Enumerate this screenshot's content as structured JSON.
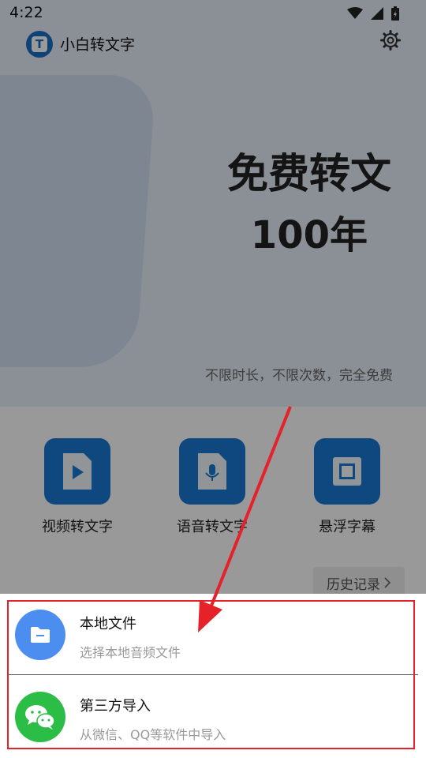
{
  "status_bar": {
    "time": "4:22",
    "icons": [
      "wifi-icon",
      "signal-icon",
      "battery-charging-icon"
    ]
  },
  "app": {
    "name": "小白转文字",
    "logo_letter": "T",
    "settings_icon": "gear-icon"
  },
  "hero": {
    "title_line1": "免费转文",
    "title_line2": "100年",
    "subtitle": "不限时长，不限次数，完全免费"
  },
  "features": [
    {
      "label": "视频转文字",
      "icon": "video-play-icon"
    },
    {
      "label": "语音转文字",
      "icon": "microphone-file-icon"
    },
    {
      "label": "悬浮字幕",
      "icon": "floating-window-icon"
    }
  ],
  "history": {
    "label": "历史记录",
    "icon": "chevron-right-icon"
  },
  "sheet": {
    "options": [
      {
        "title": "本地文件",
        "subtitle": "选择本地音频文件",
        "icon": "folder-icon",
        "icon_color": "#4c8ef0"
      },
      {
        "title": "第三方导入",
        "subtitle": "从微信、QQ等软件中导入",
        "icon": "wechat-icon",
        "icon_color": "#2bbd45"
      }
    ]
  },
  "annotation": {
    "box_color": "#e5222a",
    "arrow_color": "#e5222a"
  },
  "colors": {
    "accent": "#1a78d3",
    "overlay": "rgba(0,0,0,0.40)"
  }
}
